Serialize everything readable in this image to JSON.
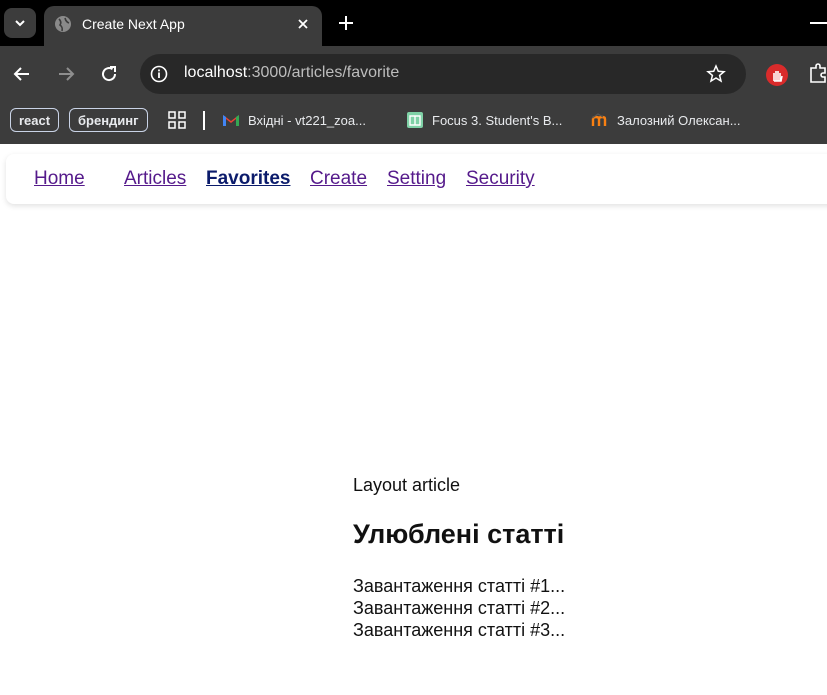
{
  "browser": {
    "tab_title": "Create Next App",
    "url_host": "localhost",
    "url_path": ":3000/articles/favorite",
    "icons": {
      "tab_search": "chevron-down-icon",
      "favicon": "globe-icon",
      "close": "close-icon",
      "new_tab": "plus-icon",
      "back": "arrow-left-icon",
      "forward": "arrow-right-icon",
      "reload": "reload-icon",
      "info": "info-icon",
      "bookmark_star": "star-icon",
      "extension": "adblock-icon",
      "extensions_menu": "puzzle-icon"
    }
  },
  "bookmarks": {
    "chips": [
      "react",
      "брендинг"
    ],
    "links": [
      {
        "label": "Вхідні - vt221_zoa...",
        "icon": "gmail-icon"
      },
      {
        "label": "Focus 3. Student's B...",
        "icon": "book-icon"
      },
      {
        "label": "Залозний Олексан...",
        "icon": "moodle-icon"
      }
    ]
  },
  "nav": {
    "items": [
      "Home",
      "Articles",
      "Favorites",
      "Create",
      "Setting",
      "Security"
    ],
    "active": "Favorites"
  },
  "content": {
    "layout_text": "Layout article",
    "title": "Улюблені статті",
    "loading_items": [
      "Завантаження статті #1...",
      "Завантаження статті #2...",
      "Завантаження статті #3..."
    ]
  },
  "colors": {
    "chrome_dark": "#000000",
    "chrome_toolbar": "#3c3c3c",
    "link_visited": "#551a8b",
    "link_active": "#0b1b6b"
  }
}
